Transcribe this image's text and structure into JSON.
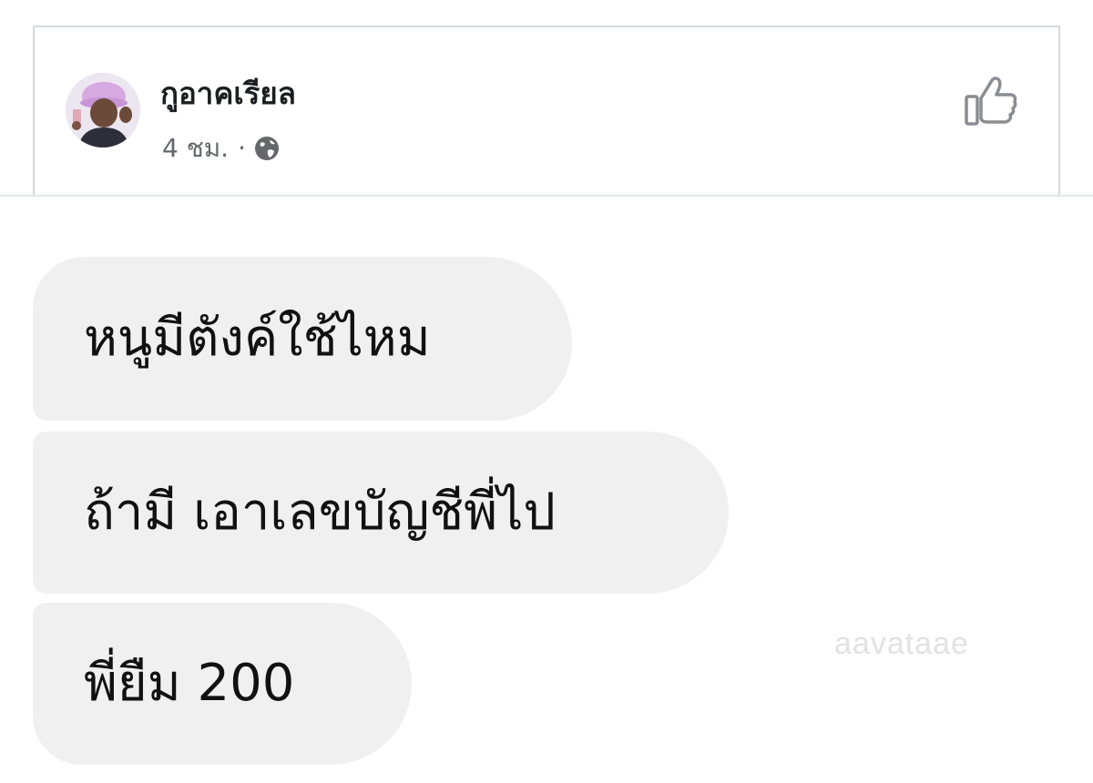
{
  "post": {
    "author_name": "กูอาคเรียล",
    "timestamp": "4 ชม.",
    "separator": "·",
    "privacy_icon": "globe-icon",
    "like_icon": "thumbs-up-icon"
  },
  "messages": [
    {
      "text": "หนูมีตังค์ใช้ไหม"
    },
    {
      "text": "ถ้ามี เอาเลขบัญชีพี่ไป"
    },
    {
      "text": "พี่ยืม 200"
    }
  ],
  "watermark": "aavataae",
  "colors": {
    "bubble_bg": "#f0f0f0",
    "meta_text": "#65676b",
    "author_text": "#1c1e21",
    "border": "#d5d7da"
  }
}
